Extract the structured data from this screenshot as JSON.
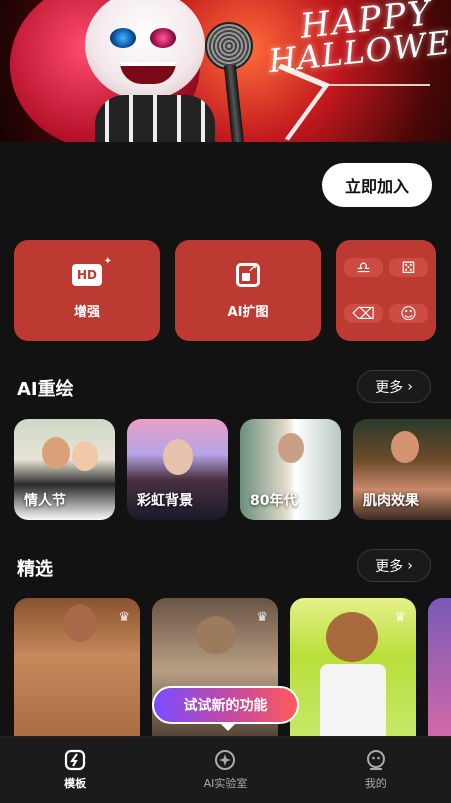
{
  "banner": {
    "title_line1": "HAPPY",
    "title_line2": "HALLOWEEN"
  },
  "join_button": "立即加入",
  "tools": [
    {
      "label": "增强",
      "icon": "hd-icon"
    },
    {
      "label": "AI扩图",
      "icon": "expand-icon"
    }
  ],
  "mini_tools": [
    {
      "icon": "hair-icon",
      "glyph": "♎"
    },
    {
      "icon": "image-tag-icon",
      "glyph": "⚄"
    },
    {
      "icon": "eraser-icon",
      "glyph": "⌫"
    },
    {
      "icon": "face-icon",
      "glyph": "☺"
    }
  ],
  "ai_repaint": {
    "title": "AI重绘",
    "more": "更多",
    "cards": [
      {
        "label": "情人节"
      },
      {
        "label": "彩虹背景"
      },
      {
        "label": "80年代"
      },
      {
        "label": "肌肉效果"
      }
    ]
  },
  "featured": {
    "title": "精选",
    "more": "更多"
  },
  "try_new": "试试新的功能",
  "nav": [
    {
      "label": "模板",
      "icon": "template-icon"
    },
    {
      "label": "AI实验室",
      "icon": "lab-icon"
    },
    {
      "label": "我的",
      "icon": "profile-icon"
    }
  ],
  "colors": {
    "accent": "#bd3a32",
    "background": "#121212"
  }
}
